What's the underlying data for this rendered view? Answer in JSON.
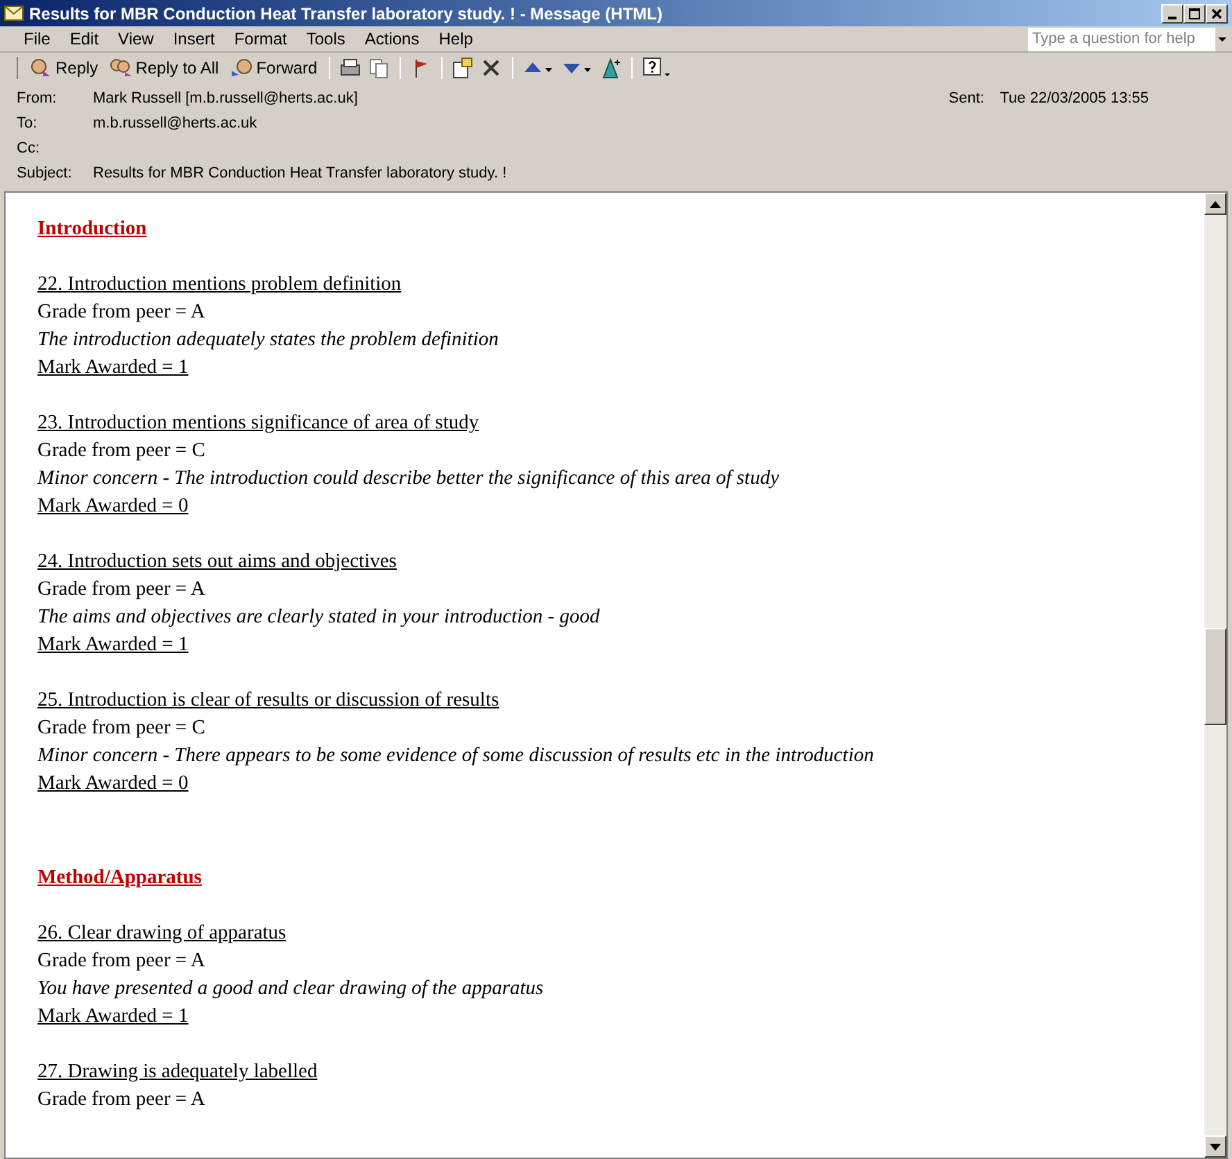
{
  "window": {
    "title": "Results for MBR Conduction Heat Transfer laboratory study.  ! - Message (HTML)"
  },
  "menu": [
    "File",
    "Edit",
    "View",
    "Insert",
    "Format",
    "Tools",
    "Actions",
    "Help"
  ],
  "help_search": {
    "placeholder": "Type a question for help"
  },
  "toolbar": [
    {
      "kind": "reply",
      "label": "Reply"
    },
    {
      "kind": "reply_all",
      "label": "Reply to All"
    },
    {
      "kind": "forward",
      "label": "Forward"
    },
    {
      "kind": "print"
    },
    {
      "kind": "copy"
    },
    {
      "kind": "flag"
    },
    {
      "kind": "move"
    },
    {
      "kind": "delete"
    },
    {
      "kind": "previous"
    },
    {
      "kind": "next"
    },
    {
      "kind": "address_book"
    },
    {
      "kind": "help"
    }
  ],
  "header": {
    "from_label": "From:",
    "from": "Mark Russell [m.b.russell@herts.ac.uk]",
    "sent_label": "Sent:",
    "sent": "Tue 22/03/2005 13:55",
    "to_label": "To:",
    "to": "m.b.russell@herts.ac.uk",
    "cc_label": "Cc:",
    "subject_label": "Subject:",
    "subject": "Results for MBR Conduction Heat Transfer laboratory study.  !"
  },
  "sections": [
    {
      "heading": "Introduction",
      "items": [
        {
          "title": "22. Introduction mentions problem definition",
          "grade": "Grade from peer = A",
          "comment": "The introduction adequately states the problem definition",
          "mark": "Mark Awarded = 1"
        },
        {
          "title": "23. Introduction mentions significance of area of study",
          "grade": "Grade from peer = C",
          "comment": "Minor concern - The introduction could describe better the significance of this area of study",
          "mark": "Mark Awarded = 0"
        },
        {
          "title": "24. Introduction sets out aims and objectives",
          "grade": "Grade from peer = A",
          "comment": "The aims and objectives are clearly stated in your introduction - good",
          "mark": "Mark Awarded = 1"
        },
        {
          "title": "25. Introduction is clear of results or discussion of results",
          "grade": "Grade from peer = C",
          "comment": "Minor concern - There appears to be some evidence of some discussion of results etc in the introduction",
          "mark": "Mark Awarded = 0"
        }
      ]
    },
    {
      "heading": "Method/Apparatus",
      "items": [
        {
          "title": "26. Clear drawing of apparatus",
          "grade": "Grade from peer = A",
          "comment": "You have presented a good and clear drawing of the apparatus",
          "mark": "Mark Awarded = 1"
        },
        {
          "title": "27. Drawing is adequately labelled",
          "grade": "Grade from peer = A"
        }
      ]
    }
  ]
}
